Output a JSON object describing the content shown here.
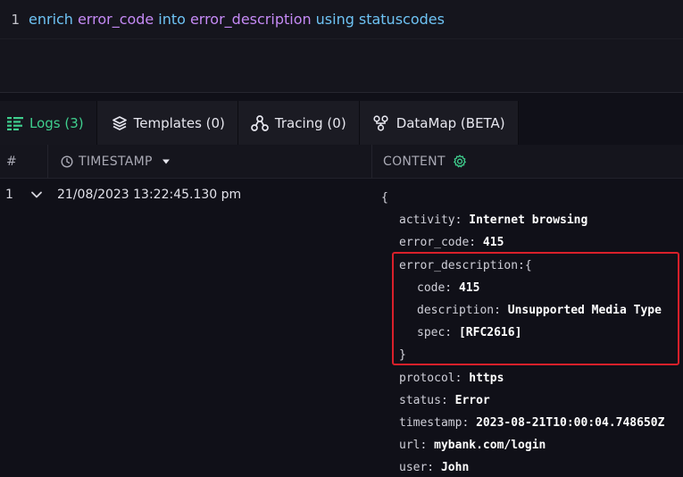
{
  "editor": {
    "line_number": "1",
    "query": {
      "kw1": "enrich",
      "field": "error_code",
      "kw2": "into",
      "target": "error_description",
      "kw3": "using",
      "table": "statuscodes"
    }
  },
  "tabs": [
    {
      "label": "Logs (3)",
      "icon": "logs-icon",
      "active": true
    },
    {
      "label": "Templates (0)",
      "icon": "templates-icon",
      "active": false
    },
    {
      "label": "Tracing (0)",
      "icon": "tracing-icon",
      "active": false
    },
    {
      "label": "DataMap (BETA)",
      "icon": "datamap-icon",
      "active": false
    }
  ],
  "table": {
    "col_num": "#",
    "col_timestamp": "TIMESTAMP",
    "col_content": "CONTENT",
    "rows": [
      {
        "num": "1",
        "timestamp": "21/08/2023 13:22:45.130 pm",
        "content": {
          "open": "{",
          "activity_k": "activity:",
          "activity_v": "Internet browsing",
          "error_code_k": "error_code:",
          "error_code_v": "415",
          "error_description_k": "error_description:",
          "error_description_open": "{",
          "code_k": "code:",
          "code_v": "415",
          "description_k": "description:",
          "description_v": "Unsupported Media Type",
          "spec_k": "spec:",
          "spec_v": "[RFC2616]",
          "error_description_close": "}",
          "protocol_k": "protocol:",
          "protocol_v": "https",
          "status_k": "status:",
          "status_v": "Error",
          "timestamp_k": "timestamp:",
          "timestamp_v": "2023-08-21T10:00:04.748650Z",
          "url_k": "url:",
          "url_v": "mybank.com/login",
          "user_k": "user:",
          "user_v": "John"
        }
      }
    ]
  },
  "colors": {
    "keyword": "#6ec3f4",
    "identifier": "#c58af5",
    "active_tab": "#3fcf8e",
    "highlight_border": "#d9202a"
  }
}
